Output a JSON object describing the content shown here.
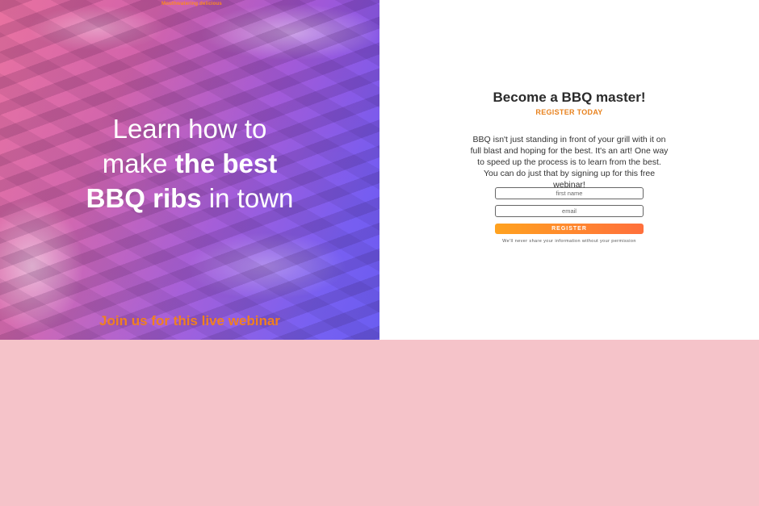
{
  "hero": {
    "logo_tagline": "Mouthwatering delicious",
    "headline_line1": "Learn how to",
    "headline_line2_light": "make ",
    "headline_line2_bold": "the best",
    "headline_line3_bold": "BBQ ribs",
    "headline_line3_light": " in town",
    "webinar_text": "Join us for this live webinar"
  },
  "form": {
    "title": "Become a BBQ master!",
    "subtitle": "REGISTER TODAY",
    "description": "BBQ isn't just standing in front of your grill with it on full blast and hoping for the best. It's an art! One way to speed up the process is to learn from the best. You can do just that by signing up for this free webinar!",
    "first_name_placeholder": "first name",
    "email_placeholder": "email",
    "register_label": "REGISTER",
    "privacy_note": "We'll never share your information without your permission"
  },
  "colors": {
    "accent_orange": "#f08020",
    "page_background": "#f5c3c9",
    "hero_purple": "#6a4ff0",
    "hero_pink": "#e86a9a"
  }
}
